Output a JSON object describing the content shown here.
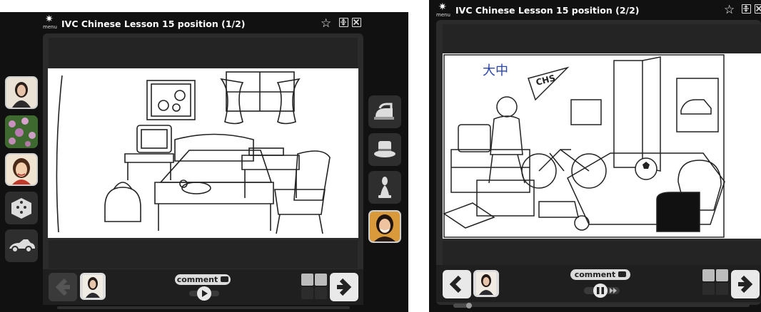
{
  "colors": {
    "panel_bg": "#111111",
    "stage_bg": "#2b2b2b",
    "button_light": "#e9e9e9",
    "button_dark": "#2e2e2e",
    "title_text": "#ffffff"
  },
  "left_window": {
    "title": "IVC Chinese Lesson 15 position (1/2)",
    "menu_label": "menu",
    "comment_label": "comment",
    "playback_state": "paused",
    "progress": 0.0,
    "left_tools": [
      "avatar-woman-photo",
      "flowers-photo",
      "avatar-woman-cartoon",
      "dice-icon",
      "car-icon"
    ],
    "right_tools": [
      "iron-icon",
      "hat-icon",
      "chess-piece-icon",
      "avatar-woman-photo"
    ]
  },
  "right_window": {
    "title": "IVC Chinese Lesson 15 position (2/2)",
    "menu_label": "menu",
    "comment_label": "comment",
    "playback_state": "playing",
    "progress": 0.05,
    "poster_text": "大中",
    "pennant_text": "CHS"
  },
  "icons": {
    "menu": "gear-icon",
    "favorite": "star-icon",
    "fit": "fit-screen-icon",
    "close": "close-icon",
    "prev": "arrow-left-icon",
    "next": "arrow-right-icon",
    "comment": "speech-bubble-icon",
    "play": "play-icon",
    "pause": "pause-icon"
  }
}
